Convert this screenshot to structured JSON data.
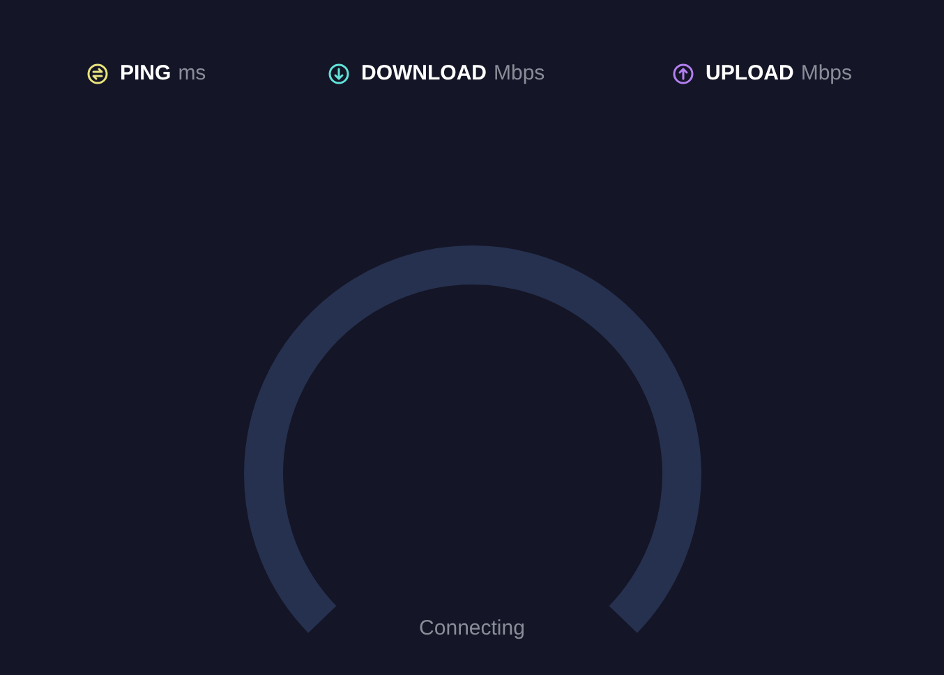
{
  "metrics": [
    {
      "kind": "ping",
      "label": "PING",
      "unit": "ms",
      "color": "#e9e47c"
    },
    {
      "kind": "download",
      "label": "DOWNLOAD",
      "unit": "Mbps",
      "color": "#62e2d9"
    },
    {
      "kind": "upload",
      "label": "UPLOAD",
      "unit": "Mbps",
      "color": "#b37ff0"
    }
  ],
  "gauge": {
    "status": "Connecting"
  }
}
